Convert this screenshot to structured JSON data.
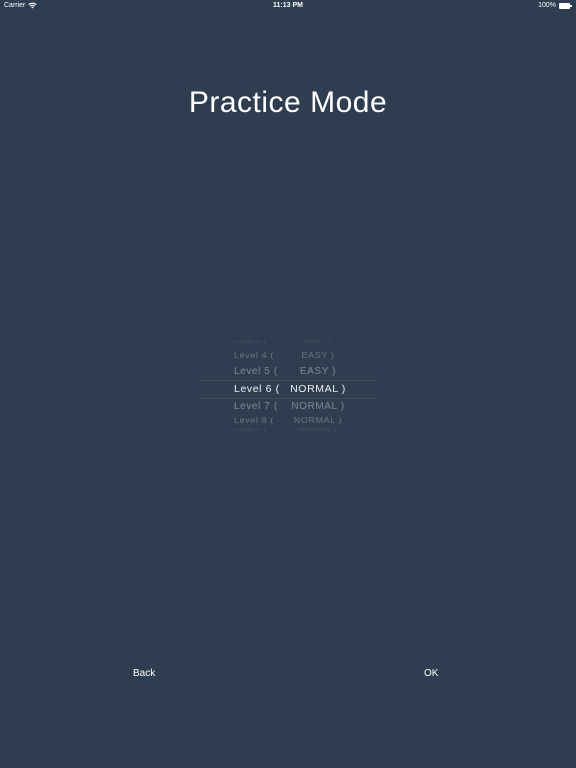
{
  "status_bar": {
    "carrier": "Carrier",
    "time": "11:13 PM",
    "battery": "100%",
    "icons": [
      "wifi-icon",
      "battery-icon"
    ]
  },
  "title": "Practice Mode",
  "picker": {
    "rows": [
      {
        "level": "Level 3 (",
        "difficulty": "EASY )"
      },
      {
        "level": "Level 4 (",
        "difficulty": "EASY )"
      },
      {
        "level": "Level 5 (",
        "difficulty": "EASY )"
      },
      {
        "level": "Level 6 (",
        "difficulty": "NORMAL )"
      },
      {
        "level": "Level 7 (",
        "difficulty": "NORMAL )"
      },
      {
        "level": "Level 8 (",
        "difficulty": "NORMAL )"
      },
      {
        "level": "Level 9 (",
        "difficulty": "NORMAL )"
      }
    ],
    "selected_index": 3
  },
  "buttons": {
    "back_label": "Back",
    "ok_label": "OK"
  },
  "colors": {
    "background": "#2e3d4f",
    "text": "#ffffff"
  }
}
